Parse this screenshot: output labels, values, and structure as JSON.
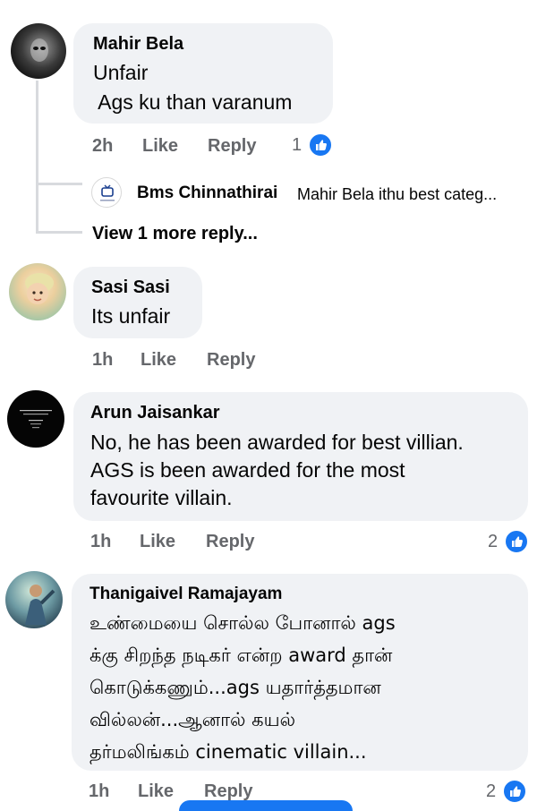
{
  "comments": [
    {
      "author": "Mahir Bela",
      "lines": [
        "Unfair",
        " Ags ku than varanum"
      ],
      "time": "2h",
      "like": "Like",
      "reply": "Reply",
      "reactions": "1",
      "replies": {
        "preview_author": "Bms Chinnathirai",
        "preview_text": "Mahir Bela ithu best categ...",
        "more": "View 1 more reply..."
      }
    },
    {
      "author": "Sasi Sasi",
      "lines": [
        "Its unfair"
      ],
      "time": "1h",
      "like": "Like",
      "reply": "Reply"
    },
    {
      "author": "Arun Jaisankar",
      "lines": [
        "No, he has been awarded for best villian.",
        "AGS is been awarded for the most",
        "favourite villain."
      ],
      "time": "1h",
      "like": "Like",
      "reply": "Reply",
      "reactions": "2"
    },
    {
      "author": "Thanigaivel Ramajayam",
      "lines": [
        "உண்மையை சொல்ல போனால் ags",
        "க்கு சிறந்த நடிகர் என்ற award தான்",
        "கொடுக்கணும்...ags யதார்த்தமான",
        "வில்லன்...ஆனால் கயல்",
        "தர்மலிங்கம் cinematic villain..."
      ],
      "time": "1h",
      "like": "Like",
      "reply": "Reply",
      "reactions": "2"
    }
  ],
  "colors": {
    "bubble": "#f0f2f5",
    "meta_text": "#65676b",
    "like_blue": "#1877f2",
    "thread_line": "#d8dade"
  },
  "icons": {
    "reaction": "thumbs-up-icon"
  }
}
